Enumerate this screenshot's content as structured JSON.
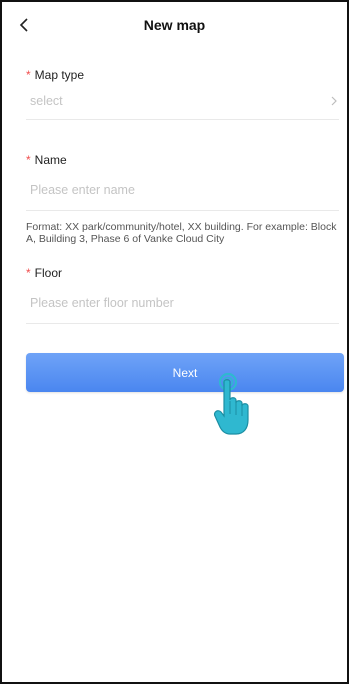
{
  "header": {
    "title": "New map",
    "back_icon": "chevron-left-icon"
  },
  "form": {
    "map_type": {
      "required_mark": "*",
      "label": "Map type",
      "placeholder": "select",
      "chevron_icon": "chevron-right-icon"
    },
    "name": {
      "required_mark": "*",
      "label": "Name",
      "placeholder": "Please enter name",
      "hint": "Format: XX park/community/hotel, XX building. For example: Block A, Building 3, Phase 6 of Vanke Cloud City"
    },
    "floor": {
      "required_mark": "*",
      "label": "Floor",
      "placeholder": "Please enter floor number"
    }
  },
  "next_button": {
    "label": "Next"
  },
  "colors": {
    "required": "#f04d4d",
    "button_top": "#6fa3f7",
    "button_bottom": "#4a86f0",
    "placeholder": "#c4c4c4",
    "pointer": "#2fb8d0"
  },
  "pointer_icon": "hand-pointer-icon"
}
